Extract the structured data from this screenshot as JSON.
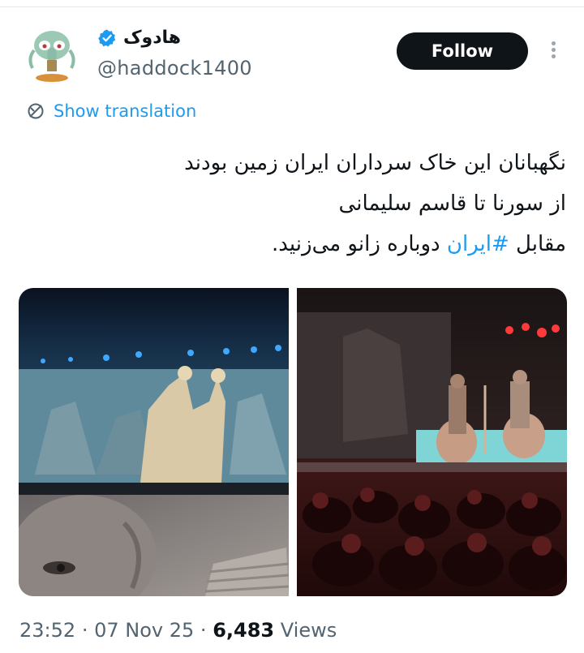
{
  "tweet": {
    "display_name": "هادوک",
    "handle": "@haddock1400",
    "follow_label": "Follow",
    "translate_label": "Show translation",
    "text_lines": [
      "نگهبانان این خاک سرداران ایران زمین بودند",
      "از سورنا تا قاسم سلیمانی"
    ],
    "line3_start": "مقابل ",
    "hashtag": "#ایران",
    "line3_end": " دوباره زانو می‌زنید.",
    "time": "23:52",
    "date": "07 Nov 25",
    "sep": "·",
    "views_count": "6,483",
    "views_label": "Views"
  },
  "icons": {
    "verified": "verified-badge-icon",
    "translate": "globe-translate-icon",
    "more": "more-options-icon"
  },
  "colors": {
    "accent": "#1d9bf0",
    "follow_bg": "#0f1419",
    "secondary_text": "#536471"
  }
}
